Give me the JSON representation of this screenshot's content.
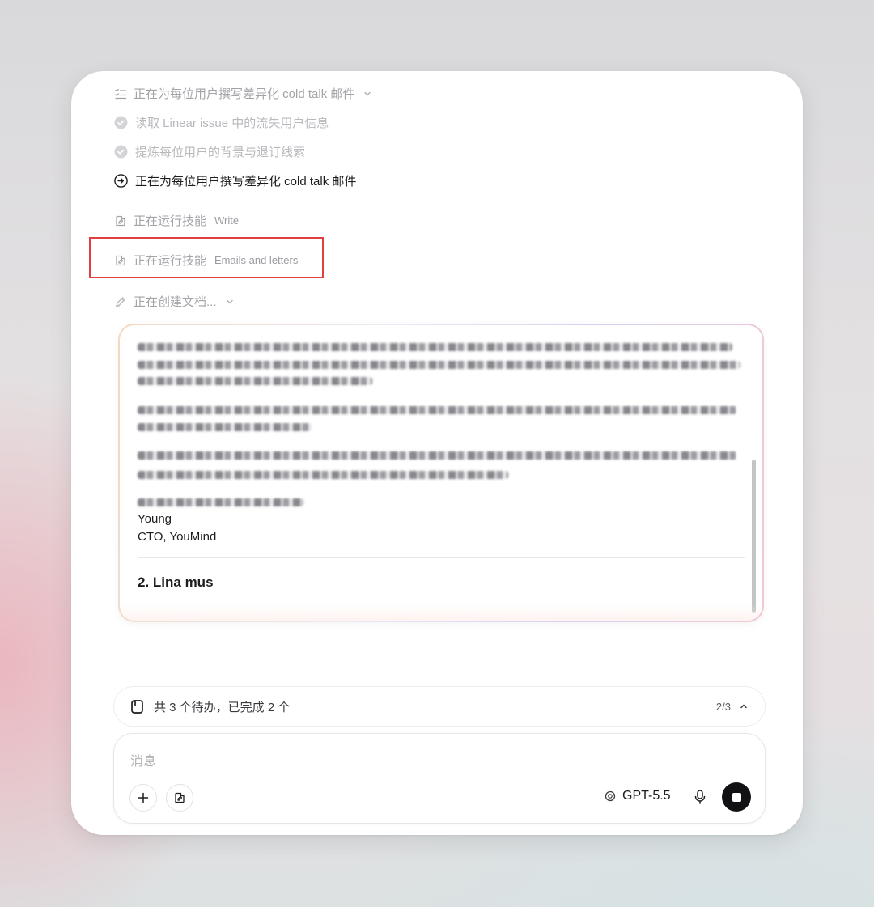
{
  "tasks": {
    "header_label": "正在为每位用户撰写差异化 cold talk 邮件",
    "steps": [
      {
        "label": "读取 Linear issue 中的流失用户信息",
        "status": "done"
      },
      {
        "label": "提炼每位用户的背景与退订线索",
        "status": "done"
      },
      {
        "label": "正在为每位用户撰写差异化 cold talk 邮件",
        "status": "in_progress"
      }
    ]
  },
  "skills": [
    {
      "label": "正在运行技能",
      "name": "Write"
    },
    {
      "label": "正在运行技能",
      "name": "Emails and letters"
    }
  ],
  "doc_status": {
    "label": "正在创建文档..."
  },
  "document": {
    "signature_name": "Young",
    "signature_title": "CTO, YouMind",
    "next_heading": "2. Lina mus"
  },
  "todo": {
    "summary": "共 3 个待办，已完成 2 个",
    "progress": "2/3"
  },
  "composer": {
    "placeholder": "消息",
    "model": "GPT-5.5"
  },
  "icons": {
    "task_list": "list-check-icon",
    "step_done": "check-circle-icon",
    "step_active": "arrow-circle-icon",
    "skill": "skill-icon",
    "doc": "pen-icon",
    "todo": "clipboard-icon",
    "add": "plus-icon",
    "tools": "skill-icon",
    "model": "openai-icon",
    "mic": "mic-icon",
    "stop": "stop-icon"
  },
  "colors": {
    "highlight_border": "#e0403e",
    "stop_button": "#111113"
  }
}
